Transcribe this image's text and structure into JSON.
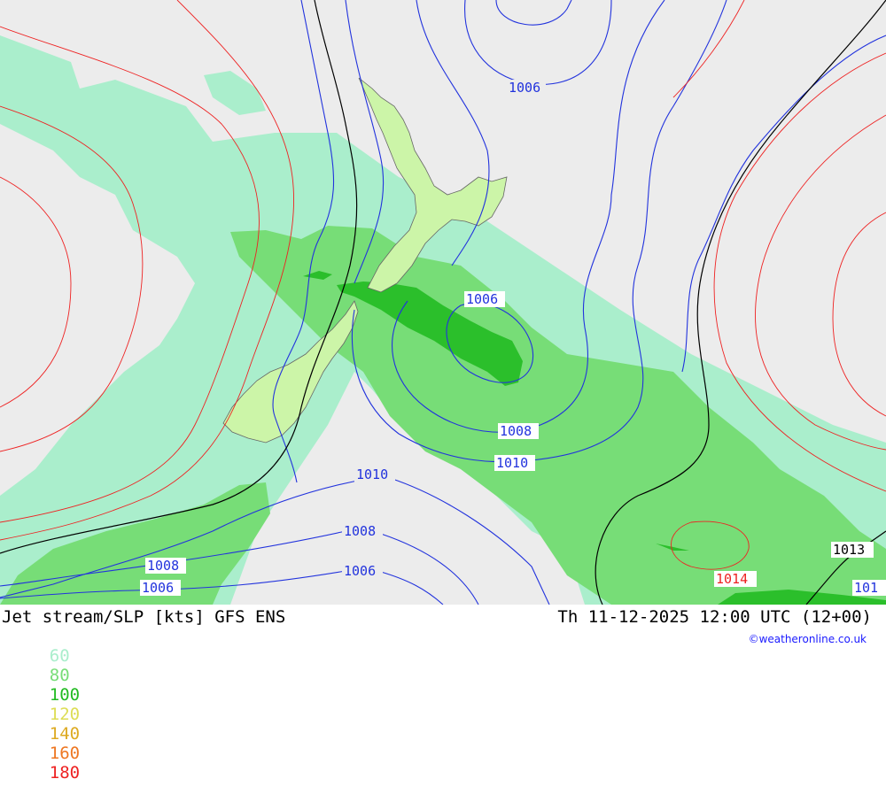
{
  "title": "Jet stream/SLP [kts] GFS ENS",
  "valid_time": "Th 11-12-2025 12:00 UTC (12+00)",
  "credit": "©weatheronline.co.uk",
  "legend": {
    "items": [
      {
        "label": "60",
        "color": "#aaeecc"
      },
      {
        "label": "80",
        "color": "#77dd77"
      },
      {
        "label": "100",
        "color": "#22bb22"
      },
      {
        "label": "120",
        "color": "#dddd55"
      },
      {
        "label": "140",
        "color": "#ddaa22"
      },
      {
        "label": "160",
        "color": "#ee7722"
      },
      {
        "label": "180",
        "color": "#ee2222"
      }
    ]
  },
  "isobar_labels": [
    {
      "text": "1006",
      "color": "#2233dd"
    },
    {
      "text": "1006",
      "color": "#2233dd"
    },
    {
      "text": "1008",
      "color": "#2233dd"
    },
    {
      "text": "1010",
      "color": "#2233dd"
    },
    {
      "text": "1010",
      "color": "#2233dd"
    },
    {
      "text": "1008",
      "color": "#2233dd"
    },
    {
      "text": "1008",
      "color": "#2233dd"
    },
    {
      "text": "1006",
      "color": "#2233dd"
    },
    {
      "text": "1006",
      "color": "#2233dd"
    },
    {
      "text": "1013",
      "color": "#000000"
    },
    {
      "text": "1014",
      "color": "#ee2222"
    },
    {
      "text": "101",
      "color": "#2233dd"
    }
  ],
  "colors": {
    "background": "#ececec",
    "land": "#ccf5a8",
    "isobar_low": "#2233dd",
    "isobar_std": "#000000",
    "isobar_high": "#ee2222"
  }
}
